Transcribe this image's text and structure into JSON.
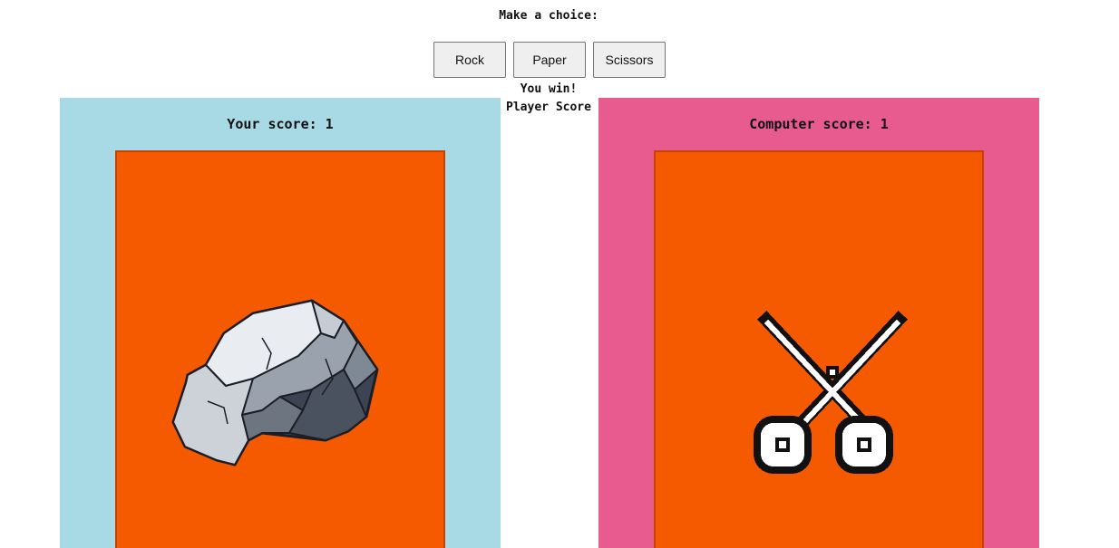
{
  "prompt": "Make a choice:",
  "choices": [
    {
      "label": "Rock"
    },
    {
      "label": "Paper"
    },
    {
      "label": "Scissors"
    }
  ],
  "result": {
    "message": "You win!",
    "caption": "Player Score"
  },
  "player": {
    "score_text": "Your score: 1",
    "choice_icon": "rock-icon",
    "panel_color": "#a8dae6"
  },
  "computer": {
    "score_text": "Computer score: 1",
    "choice_icon": "scissors-icon",
    "panel_color": "#e85b8f"
  },
  "colors": {
    "card": "#f55a00",
    "card_border": "#c84100"
  }
}
